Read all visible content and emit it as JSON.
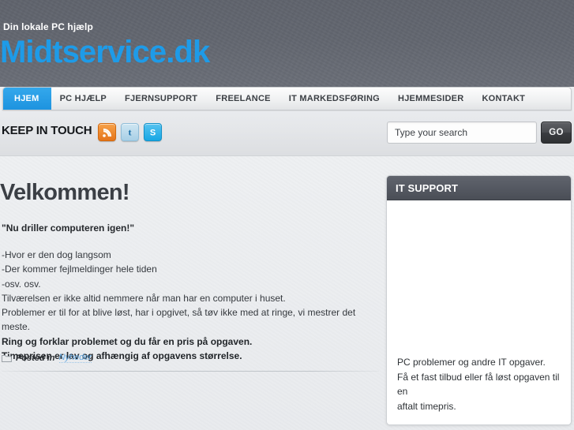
{
  "header": {
    "tagline": "Din lokale PC hjælp",
    "site_title": "Midtservice.dk",
    "brand_color": "#1e9be8",
    "bg_color": "#62666f"
  },
  "nav": {
    "items": [
      {
        "label": "HJEM",
        "active": true
      },
      {
        "label": "PC HJÆLP",
        "active": false
      },
      {
        "label": "FJERNSUPPORT",
        "active": false
      },
      {
        "label": "FREELANCE",
        "active": false
      },
      {
        "label": "IT MARKEDSFØRING",
        "active": false
      },
      {
        "label": "HJEMMESIDER",
        "active": false
      },
      {
        "label": "KONTAKT",
        "active": false
      }
    ],
    "active_color": "#1d93df"
  },
  "touchbar": {
    "label": "KEEP IN TOUCH",
    "social": [
      {
        "name": "rss-icon",
        "title": "RSS",
        "color": "#e5751b"
      },
      {
        "name": "twitter-icon",
        "title": "Twitter",
        "color": "#a8cfe6"
      },
      {
        "name": "skype-icon",
        "title": "Skype",
        "color": "#17a7e4"
      }
    ]
  },
  "search": {
    "placeholder": "Type your search",
    "value": "",
    "button_label": "GO"
  },
  "post": {
    "title": "Velkommen!",
    "lead": "\"Nu driller computeren igen!\"",
    "lines": [
      {
        "text": "-Hvor er den dog langsom",
        "bold": false
      },
      {
        "text": "-Der kommer fejlmeldinger hele tiden",
        "bold": false
      },
      {
        "text": "-osv. osv.",
        "bold": false
      },
      {
        "text": "Tilværelsen er ikke altid nemmere når man har en computer i huset.",
        "bold": false
      },
      {
        "text": "Problemer er til for at blive løst, har i opgivet, så tøv ikke med at ringe, vi mestrer det meste.",
        "bold": false
      },
      {
        "text": "Ring og forklar problemet og du får en pris på opgaven.",
        "bold": true
      },
      {
        "text": "Timeprisen er lav og afhængig af opgavens størrelse.",
        "bold": true
      }
    ],
    "meta_label": "Posted in",
    "meta_category": "Nyheder"
  },
  "sidebar": {
    "widget_title": "IT SUPPORT",
    "widget_text_lines": [
      "PC problemer og andre IT opgaver.",
      "Få et fast tilbud eller få løst opgaven til en",
      "aftalt timepris."
    ]
  }
}
